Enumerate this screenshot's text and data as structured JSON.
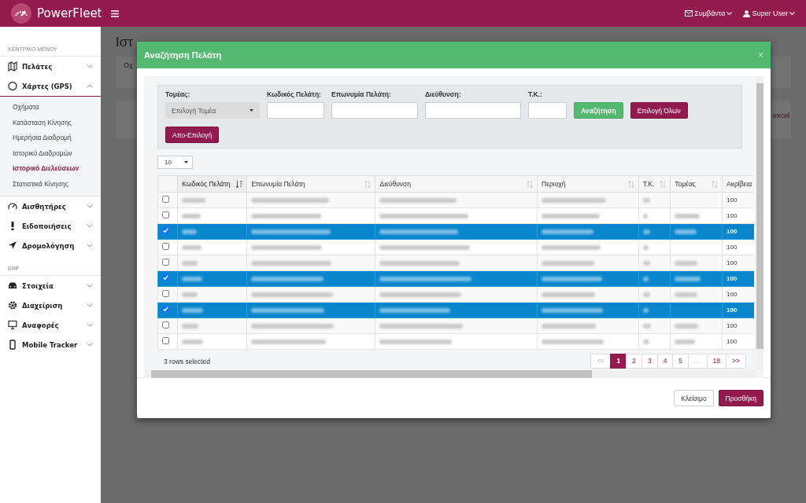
{
  "topbar": {
    "brand": "PowerFleet",
    "links": [
      {
        "label": "Συμβάντα",
        "kind": "mail"
      },
      {
        "label": "Super User",
        "kind": "user"
      }
    ]
  },
  "sidebar": {
    "sections": [
      {
        "heading": "ΚΕΝΤΡΙΚΟ ΜΕΝΟΥ",
        "items": [
          {
            "label": "Πελάτες",
            "kind": "map",
            "expanded": false
          },
          {
            "label": "Χάρτες (GPS)",
            "kind": "circle",
            "expanded": true,
            "children": [
              {
                "label": "Οχήματα",
                "selected": false
              },
              {
                "label": "Κατάσταση Κίνησης",
                "selected": false
              },
              {
                "label": "Ημερήσια Διαδρομή",
                "selected": false
              },
              {
                "label": "Ιστορικό Διαδρομών",
                "selected": false
              },
              {
                "label": "Ιστορικό Διελεύσεων",
                "selected": true
              },
              {
                "label": "Στατιστικά Κίνησης",
                "selected": false
              }
            ]
          },
          {
            "label": "Αισθητήρες",
            "kind": "gauge",
            "expanded": false
          },
          {
            "label": "Ειδοποιήσεις",
            "kind": "alert",
            "expanded": false
          },
          {
            "label": "Δρομολόγηση",
            "kind": "arrow",
            "expanded": false
          }
        ]
      },
      {
        "heading": "ERP",
        "items": [
          {
            "label": "Στοιχεία",
            "kind": "car",
            "expanded": false
          },
          {
            "label": "Διαχείριση",
            "kind": "gear",
            "expanded": false
          },
          {
            "label": "Αναφορές",
            "kind": "monitor",
            "expanded": false
          },
          {
            "label": "Mobile Tracker",
            "kind": "mobile",
            "expanded": false
          }
        ]
      }
    ]
  },
  "page": {
    "title": "Ιστ",
    "field_label": "Οχ",
    "export_link": "excel"
  },
  "modal": {
    "title": "Αναζήτηση Πελάτη",
    "close": "×",
    "filters": [
      {
        "label": "Τομέας:",
        "kind": "select",
        "value": "Επιλογή Τομέα"
      },
      {
        "label": "Κωδικός Πελάτη:",
        "kind": "text"
      },
      {
        "label": "Επωνυμία Πελάτη:",
        "kind": "text"
      },
      {
        "label": "Διεύθυνση:",
        "kind": "text"
      },
      {
        "label": "Τ.Κ.:",
        "kind": "text"
      }
    ],
    "filter_buttons": [
      {
        "label": "Αναζήτηση",
        "kind": "success"
      },
      {
        "label": "Επιλογή Όλων",
        "kind": "primary"
      },
      {
        "label": "Απο-Επιλογή",
        "kind": "primary"
      }
    ],
    "page_length": "10",
    "columns": [
      {
        "label": "Κωδικός Πελάτη",
        "sortable": true,
        "sorted": true
      },
      {
        "label": "Επωνυμία Πελάτη",
        "sortable": true,
        "sorted": false
      },
      {
        "label": "Διεύθυνση",
        "sortable": true,
        "sorted": false
      },
      {
        "label": "Περιοχή",
        "sortable": true,
        "sorted": false
      },
      {
        "label": "Τ.Κ.",
        "sortable": true,
        "sorted": false
      },
      {
        "label": "Τομέας",
        "sortable": true,
        "sorted": false
      },
      {
        "label": "Ακρίβεια"
      }
    ],
    "rows": [
      {
        "selected": false,
        "redacted": [
          true,
          true,
          true,
          true,
          true,
          false
        ],
        "accuracy": "100"
      },
      {
        "selected": false,
        "redacted": [
          true,
          true,
          true,
          true,
          true,
          true
        ],
        "accuracy": "100"
      },
      {
        "selected": true,
        "redacted": [
          true,
          true,
          true,
          true,
          true,
          true
        ],
        "accuracy": "100"
      },
      {
        "selected": false,
        "redacted": [
          true,
          true,
          true,
          true,
          true,
          false
        ],
        "accuracy": "100"
      },
      {
        "selected": false,
        "redacted": [
          true,
          true,
          true,
          true,
          true,
          true
        ],
        "accuracy": "100"
      },
      {
        "selected": true,
        "redacted": [
          true,
          true,
          true,
          true,
          true,
          true
        ],
        "accuracy": "100"
      },
      {
        "selected": false,
        "redacted": [
          true,
          true,
          true,
          true,
          true,
          true
        ],
        "accuracy": "100"
      },
      {
        "selected": true,
        "redacted": [
          true,
          true,
          true,
          true,
          true,
          false
        ],
        "accuracy": "100"
      },
      {
        "selected": false,
        "redacted": [
          true,
          true,
          true,
          true,
          true,
          true
        ],
        "accuracy": "100"
      },
      {
        "selected": false,
        "redacted": [
          true,
          true,
          true,
          true,
          true,
          true
        ],
        "accuracy": "100"
      }
    ],
    "info": "3 rows selected",
    "pages": [
      {
        "label": "<<",
        "selected": false,
        "disabled": true
      },
      {
        "label": "1",
        "selected": true,
        "disabled": false
      },
      {
        "label": "2",
        "selected": false,
        "disabled": false
      },
      {
        "label": "3",
        "selected": false,
        "disabled": false
      },
      {
        "label": "4",
        "selected": false,
        "disabled": false
      },
      {
        "label": "5",
        "selected": false,
        "disabled": false
      },
      {
        "label": "…",
        "selected": false,
        "disabled": true
      },
      {
        "label": "18",
        "selected": false,
        "disabled": false
      },
      {
        "label": ">>",
        "selected": false,
        "disabled": false
      }
    ],
    "footer_buttons": [
      {
        "label": "Κλείσιμο",
        "kind": "default"
      },
      {
        "label": "Προσθήκη",
        "kind": "primary"
      }
    ]
  }
}
